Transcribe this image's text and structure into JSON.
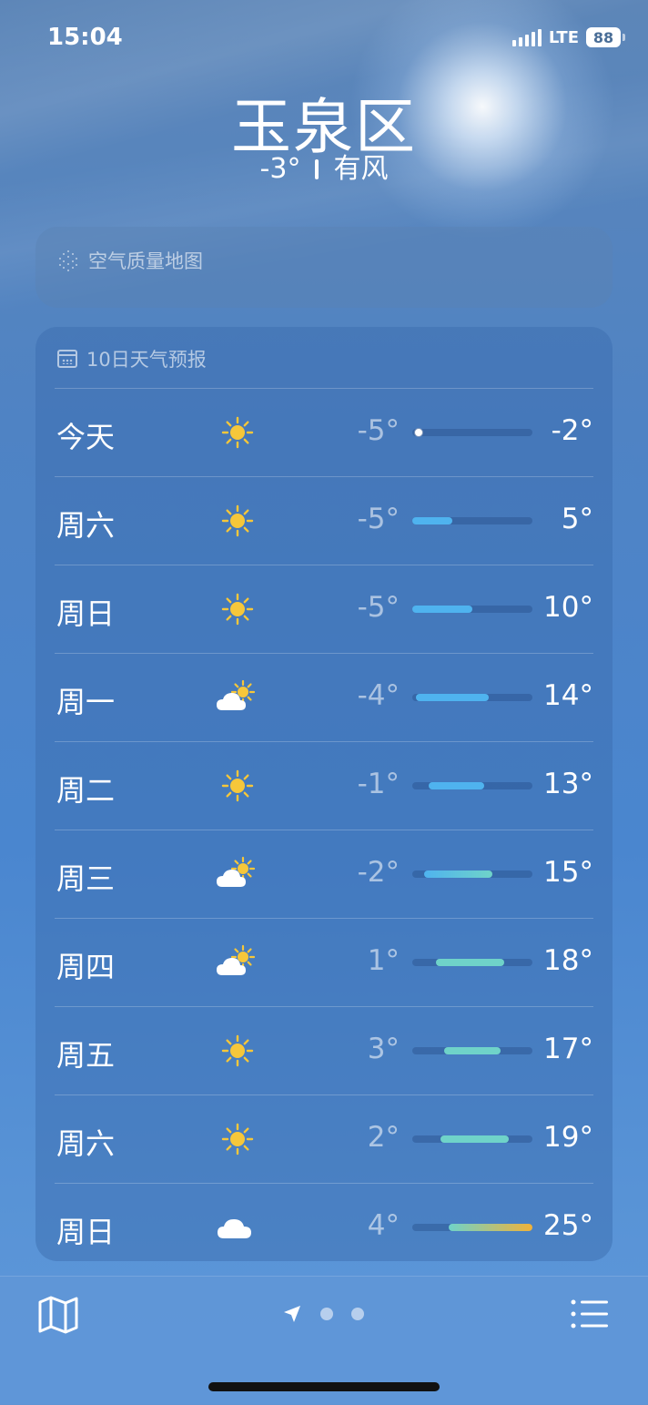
{
  "status_bar": {
    "time": "15:04",
    "network": "LTE",
    "battery": "88"
  },
  "location": {
    "city": "玉泉区",
    "temperature": "-3°",
    "condition": "有风"
  },
  "air_quality": {
    "title": "空气质量地图"
  },
  "forecast": {
    "title": "10日天气预报",
    "days": [
      {
        "day": "今天",
        "icon": "sunny-icon",
        "low": "-5°",
        "high": "-2°",
        "current_marker": true
      },
      {
        "day": "周六",
        "icon": "sunny-icon",
        "low": "-5°",
        "high": "5°"
      },
      {
        "day": "周日",
        "icon": "sunny-icon",
        "low": "-5°",
        "high": "10°"
      },
      {
        "day": "周一",
        "icon": "partly-cloudy-icon",
        "low": "-4°",
        "high": "14°"
      },
      {
        "day": "周二",
        "icon": "sunny-icon",
        "low": "-1°",
        "high": "13°"
      },
      {
        "day": "周三",
        "icon": "partly-cloudy-icon",
        "low": "-2°",
        "high": "15°"
      },
      {
        "day": "周四",
        "icon": "partly-cloudy-icon",
        "low": "1°",
        "high": "18°"
      },
      {
        "day": "周五",
        "icon": "sunny-icon",
        "low": "3°",
        "high": "17°"
      },
      {
        "day": "周六",
        "icon": "sunny-icon",
        "low": "2°",
        "high": "19°"
      },
      {
        "day": "周日",
        "icon": "cloudy-icon",
        "low": "4°",
        "high": "25°"
      }
    ],
    "range_low": -5,
    "range_high": 25
  },
  "toolbar": {
    "map_icon": "map-icon",
    "location_icon": "location-arrow-icon",
    "list_icon": "list-icon"
  },
  "colors": {
    "sun": "#f6c73a",
    "bar_cold": "#4fb3ef",
    "bar_mild": "#6fd3c9",
    "bar_warm": "#f0b23a"
  }
}
